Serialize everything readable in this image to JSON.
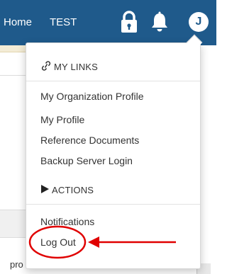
{
  "navbar": {
    "home_label": "Home",
    "test_label": "TEST",
    "avatar_initial": "J",
    "color": "#1f5a8b"
  },
  "dropdown": {
    "links_header": "MY LINKS",
    "links": [
      "My Organization Profile",
      "My Profile",
      "Reference Documents",
      "Backup Server Login"
    ],
    "actions_header": "ACTIONS",
    "actions": [
      "Notifications",
      "Log Out"
    ]
  },
  "background": {
    "partial_text": "pro"
  },
  "icons": {
    "lock": "lock-icon",
    "bell": "bell-icon",
    "links": "link-icon",
    "actions": "play-icon"
  },
  "annotation_color": "#e00000"
}
